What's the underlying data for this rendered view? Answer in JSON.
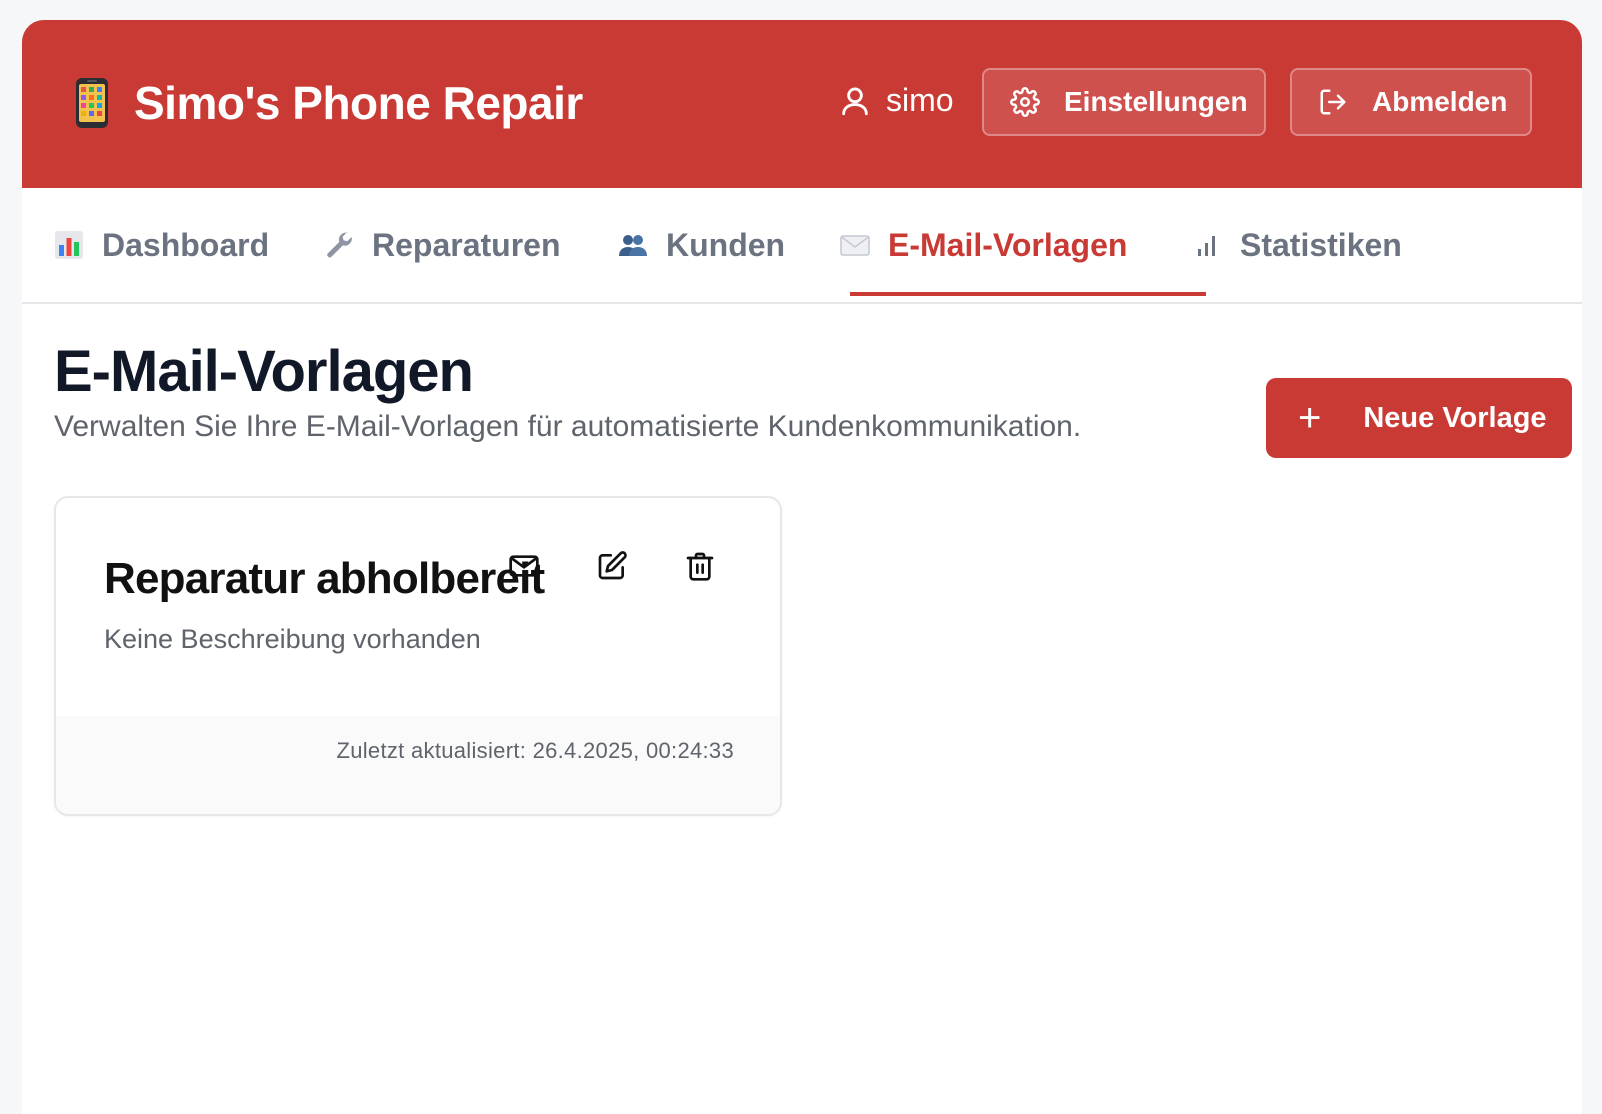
{
  "header": {
    "title": "Simo's Phone Repair",
    "brand_icon": "mobile-phone-icon",
    "username": "simo",
    "settings_label": "Einstellungen",
    "logout_label": "Abmelden",
    "accent_color": "#c93a35"
  },
  "nav": {
    "tabs": [
      {
        "label": "Dashboard",
        "icon": "bar-chart-icon"
      },
      {
        "label": "Reparaturen",
        "icon": "wrench-icon"
      },
      {
        "label": "Kunden",
        "icon": "people-icon"
      },
      {
        "label": "E-Mail-Vorlagen",
        "icon": "envelope-icon"
      },
      {
        "label": "Statistiken",
        "icon": "signal-bars-icon"
      }
    ],
    "active": "E-Mail-Vorlagen"
  },
  "main": {
    "title": "E-Mail-Vorlagen",
    "subtitle": "Verwalten Sie Ihre E-Mail-Vorlagen für automatisierte Kundenkommunikation.",
    "new_button_label": "Neue Vorlage",
    "templates": [
      {
        "name": "Reparatur abholbereit",
        "description": "Keine Beschreibung vorhanden",
        "updated": "Zuletzt aktualisiert: 26.4.2025, 00:24:33",
        "actions": [
          "mail-icon",
          "edit-icon",
          "trash-icon"
        ]
      }
    ]
  }
}
